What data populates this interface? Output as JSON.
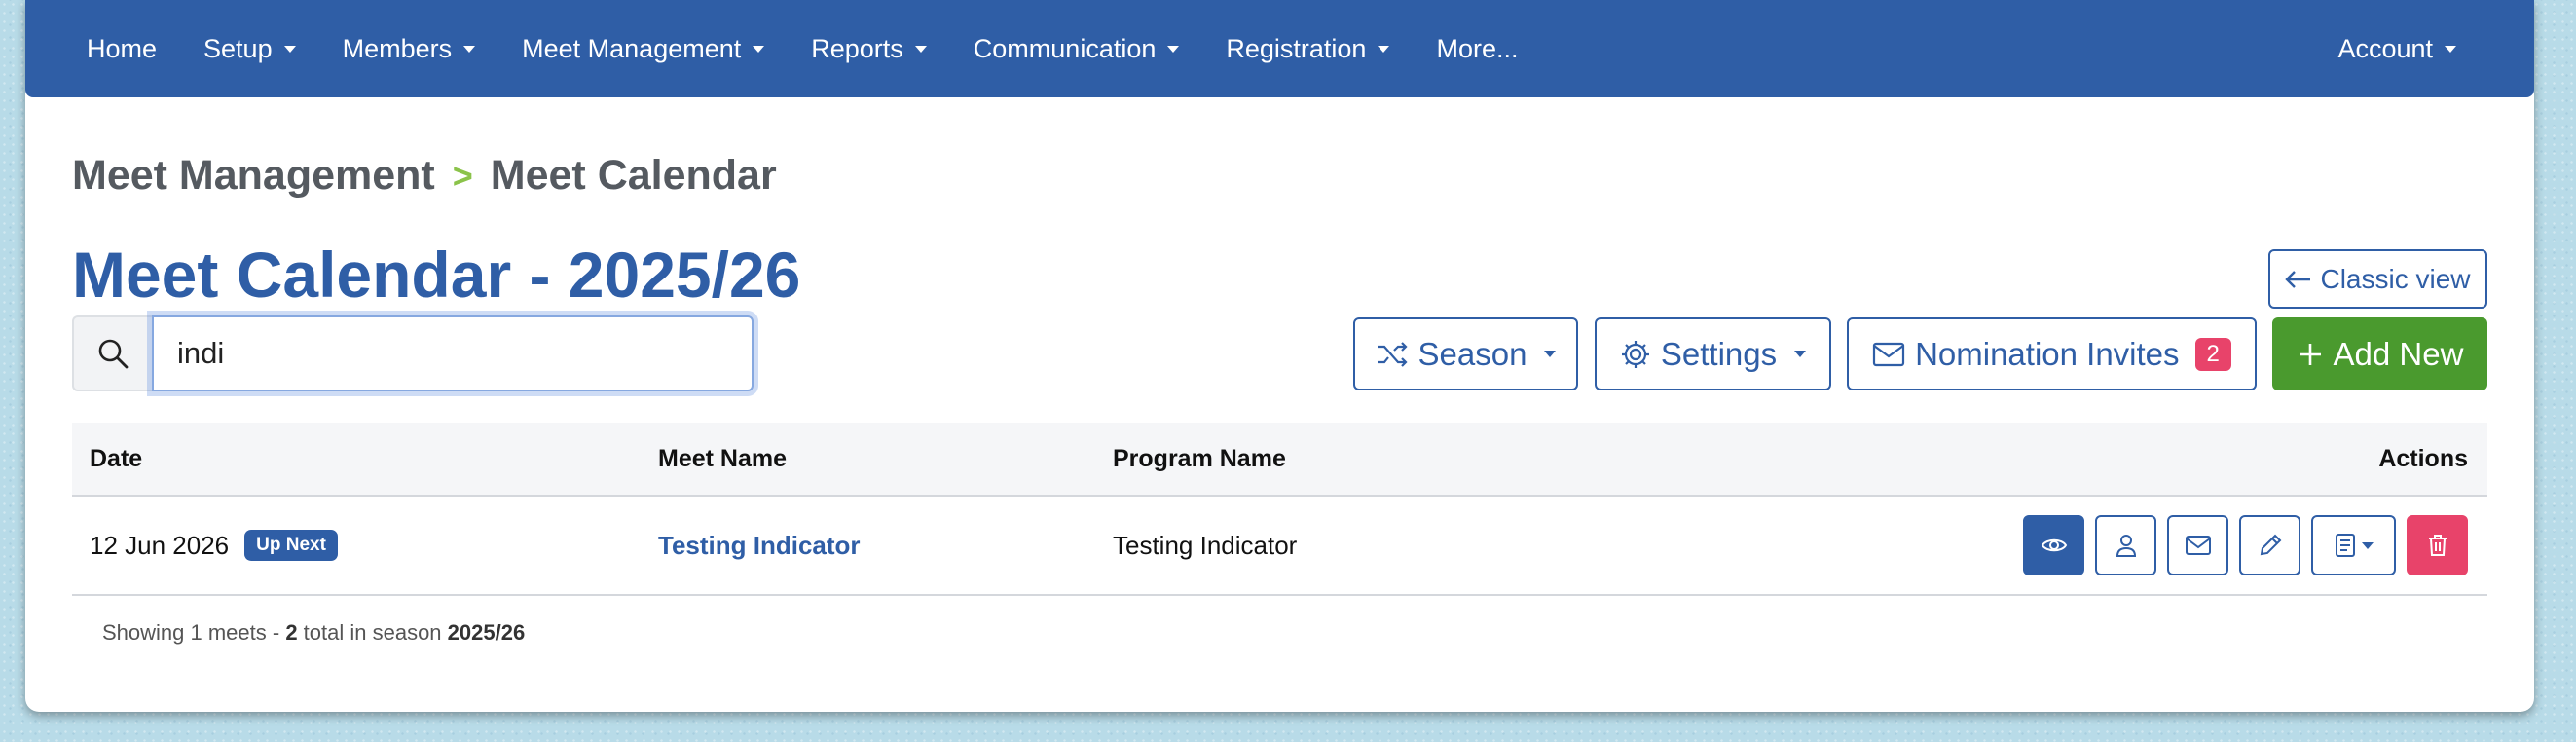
{
  "nav": {
    "items": [
      {
        "label": "Home",
        "caret": false
      },
      {
        "label": "Setup",
        "caret": true
      },
      {
        "label": "Members",
        "caret": true
      },
      {
        "label": "Meet Management",
        "caret": true
      },
      {
        "label": "Reports",
        "caret": true
      },
      {
        "label": "Communication",
        "caret": true
      },
      {
        "label": "Registration",
        "caret": true
      },
      {
        "label": "More...",
        "caret": false
      }
    ],
    "account_label": "Account"
  },
  "breadcrumb": {
    "parent": "Meet Management",
    "separator": ">",
    "current": "Meet Calendar"
  },
  "page_title": "Meet Calendar - 2025/26",
  "classic_view_label": "Classic view",
  "search": {
    "value": "indi"
  },
  "toolbar": {
    "season_label": "Season",
    "settings_label": "Settings",
    "nomination_label": "Nomination Invites",
    "nomination_count": "2",
    "add_label": "Add New"
  },
  "table": {
    "headers": {
      "date": "Date",
      "meet": "Meet Name",
      "program": "Program Name",
      "actions": "Actions"
    },
    "rows": [
      {
        "date": "12 Jun 2026",
        "badge": "Up Next",
        "meet_name": "Testing Indicator",
        "program_name": "Testing Indicator"
      }
    ]
  },
  "footer": {
    "prefix": "Showing 1 meets - ",
    "total": "2",
    "middle": " total in season ",
    "season": "2025/26"
  },
  "colors": {
    "primary": "#2f5ea6",
    "success": "#4a9a2e",
    "danger": "#e8436a",
    "accent": "#8bc34a"
  }
}
